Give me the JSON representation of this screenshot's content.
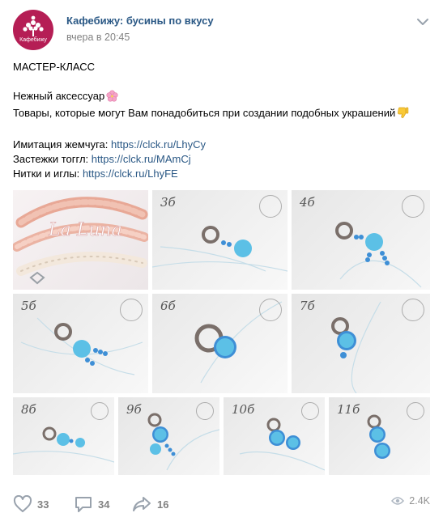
{
  "header": {
    "avatar_label": "Кафебижу",
    "author": "Кафебижу: бусины по вкусу",
    "date": "вчера в 20:45"
  },
  "post": {
    "line1": "МАСТЕР-КЛАСС",
    "line2": "Нежный аксессуар",
    "line3": "Товары, которые могут Вам понадобиться при создании подобных украшений",
    "links": [
      {
        "label": "Имитация жемчуга:",
        "url": "https://clck.ru/LhyCy"
      },
      {
        "label": "Застежки тоггл:",
        "url": "https://clck.ru/MAmCj"
      },
      {
        "label": "Нитки и иглы:",
        "url": "https://clck.ru/LhyFE"
      }
    ],
    "emoji_icons": [
      "cherry-blossom-icon",
      "thumbs-down-icon"
    ]
  },
  "gallery": {
    "cover_watermark": "La Luna",
    "steps": [
      "3б",
      "4б",
      "5б",
      "6б",
      "7б",
      "8б",
      "9б",
      "10б",
      "11б"
    ],
    "watermark": "Luna"
  },
  "footer": {
    "likes": "33",
    "comments": "34",
    "shares": "16",
    "views": "2.4K"
  },
  "colors": {
    "link": "#2a5885",
    "avatar_bg": "#b51e55",
    "muted": "#828282",
    "bead_blue": "#5cc0e6"
  }
}
